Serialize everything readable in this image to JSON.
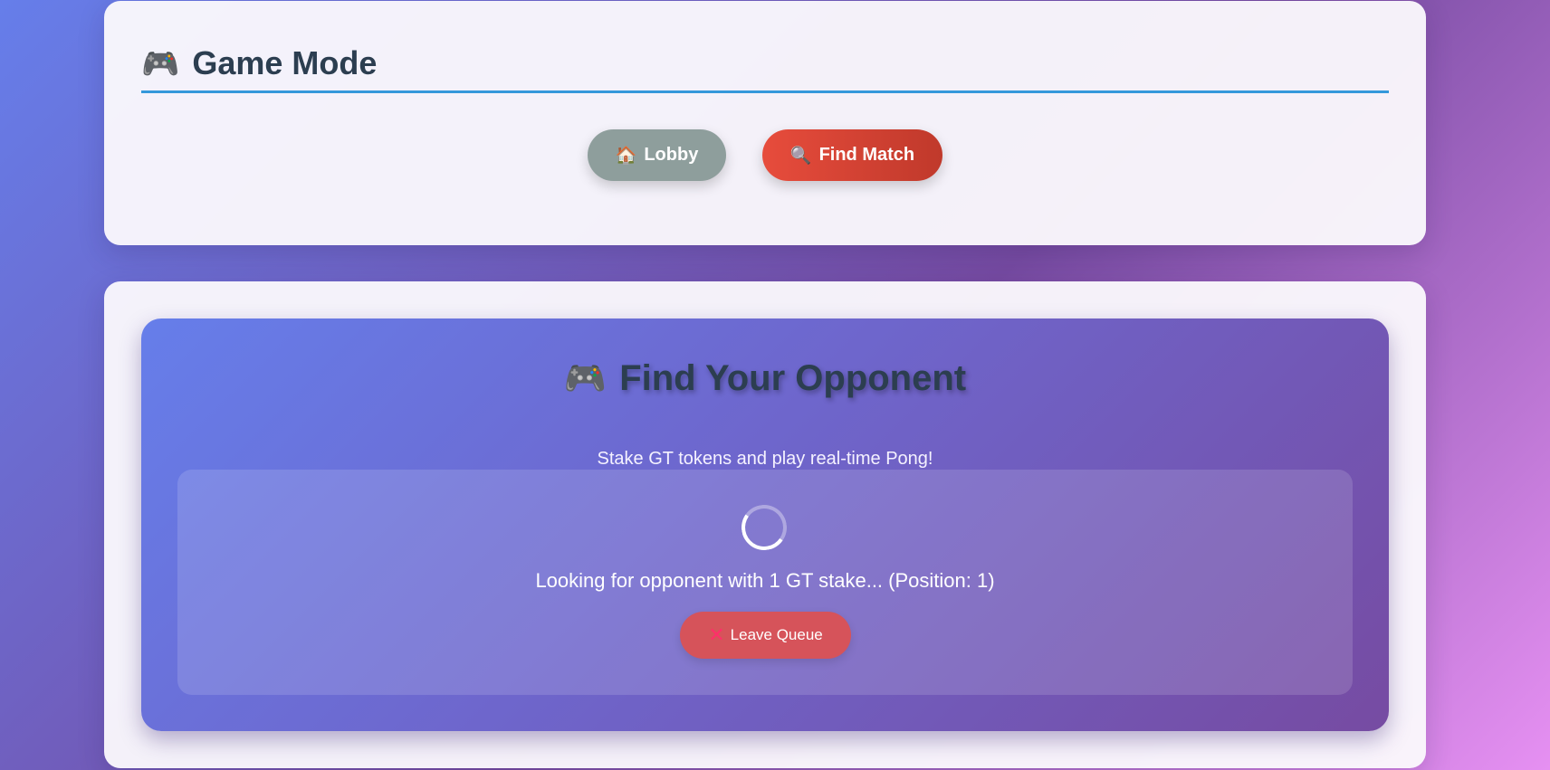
{
  "header": {
    "icon": "🎮",
    "title": "Game Mode",
    "buttons": {
      "lobby": {
        "icon": "🏠",
        "label": "Lobby"
      },
      "find_match": {
        "icon": "🔍",
        "label": "Find Match"
      }
    }
  },
  "matchmaking": {
    "icon": "🎮",
    "title": "Find Your Opponent",
    "subtitle": "Stake GT tokens and play real-time Pong!",
    "status": "Looking for opponent with 1 GT stake... (Position: 1)",
    "leave_button": {
      "icon": "✕",
      "label": "Leave Queue"
    }
  },
  "colors": {
    "accent_underline": "#3498db",
    "lobby_button": "#8e9e9c",
    "find_match_button": "#e74c3c",
    "leave_button": "#d6535a"
  }
}
